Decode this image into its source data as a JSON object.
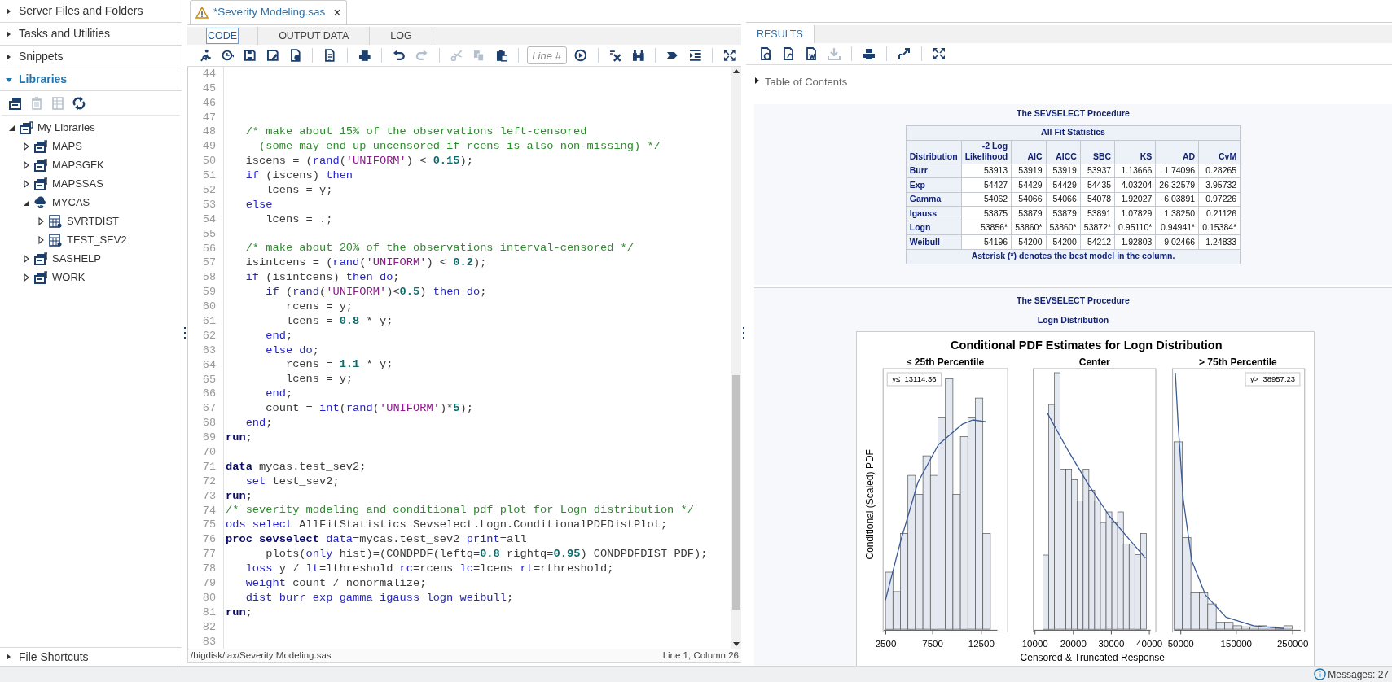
{
  "sidebar": {
    "sections": [
      {
        "label": "Server Files and Folders",
        "expanded": false
      },
      {
        "label": "Tasks and Utilities",
        "expanded": false
      },
      {
        "label": "Snippets",
        "expanded": false
      },
      {
        "label": "Libraries",
        "expanded": true
      }
    ],
    "library_toolbar": [
      {
        "kind": "new-library",
        "disabled": false
      },
      {
        "kind": "delete",
        "disabled": true
      },
      {
        "kind": "properties",
        "disabled": true
      },
      {
        "kind": "refresh",
        "disabled": false
      }
    ],
    "tree": [
      {
        "label": "My Libraries",
        "kind": "library",
        "expanded": true,
        "children": [
          {
            "label": "MAPS",
            "kind": "library",
            "expanded": false
          },
          {
            "label": "MAPSGFK",
            "kind": "library",
            "expanded": false
          },
          {
            "label": "MAPSSAS",
            "kind": "library",
            "expanded": false
          },
          {
            "label": "MYCAS",
            "kind": "cas-library",
            "expanded": true,
            "children": [
              {
                "label": "SVRTDIST",
                "kind": "table",
                "expanded": false
              },
              {
                "label": "TEST_SEV2",
                "kind": "table",
                "expanded": false
              }
            ]
          },
          {
            "label": "SASHELP",
            "kind": "library",
            "expanded": false
          },
          {
            "label": "WORK",
            "kind": "library",
            "expanded": false
          }
        ]
      }
    ],
    "footer_section": {
      "label": "File Shortcuts",
      "expanded": false
    }
  },
  "editor": {
    "tab": {
      "title": "*Severity Modeling.sas",
      "close": "×"
    },
    "subtabs": [
      {
        "label": "CODE",
        "selected": true
      },
      {
        "label": "OUTPUT DATA",
        "selected": false
      },
      {
        "label": "LOG",
        "selected": false
      }
    ],
    "toolbar": [
      {
        "kind": "run",
        "disabled": false
      },
      {
        "kind": "history",
        "disabled": false
      },
      {
        "kind": "save",
        "disabled": false
      },
      {
        "kind": "save-as",
        "disabled": false
      },
      {
        "kind": "save-other",
        "disabled": false
      },
      {
        "kind": "separator"
      },
      {
        "kind": "document",
        "disabled": false
      },
      {
        "kind": "separator"
      },
      {
        "kind": "print",
        "disabled": false
      },
      {
        "kind": "separator"
      },
      {
        "kind": "undo",
        "disabled": false
      },
      {
        "kind": "redo",
        "disabled": true
      },
      {
        "kind": "separator"
      },
      {
        "kind": "cut",
        "disabled": true
      },
      {
        "kind": "copy",
        "disabled": true
      },
      {
        "kind": "paste",
        "disabled": false
      },
      {
        "kind": "separator"
      },
      {
        "kind": "line-field",
        "placeholder": "Line #"
      },
      {
        "kind": "go",
        "disabled": false
      },
      {
        "kind": "separator"
      },
      {
        "kind": "clear",
        "disabled": false
      },
      {
        "kind": "find",
        "disabled": false
      },
      {
        "kind": "separator"
      },
      {
        "kind": "indent",
        "disabled": false
      },
      {
        "kind": "format",
        "disabled": false
      },
      {
        "kind": "separator"
      },
      {
        "kind": "fullscreen",
        "disabled": false
      }
    ],
    "lines": [
      {
        "number": "44"
      },
      {
        "number": "45"
      },
      {
        "number": "46"
      },
      {
        "number": "47"
      },
      {
        "number": "48",
        "tokens": [
          {
            "kind": "comment",
            "text": "   /* make about 15% of the observations left-censored"
          }
        ]
      },
      {
        "number": "49",
        "tokens": [
          {
            "kind": "comment",
            "text": "     (some may end up uncensored if rcens is also non-missing) */"
          }
        ]
      },
      {
        "number": "50",
        "tokens": [
          {
            "kind": "plain",
            "text": "   iscens = ("
          },
          {
            "kind": "keyword",
            "text": "rand"
          },
          {
            "kind": "plain",
            "text": "("
          },
          {
            "kind": "string",
            "text": "'UNIFORM'"
          },
          {
            "kind": "plain",
            "text": ") < "
          },
          {
            "kind": "number",
            "text": "0.15"
          },
          {
            "kind": "plain",
            "text": ");"
          }
        ]
      },
      {
        "number": "51",
        "tokens": [
          {
            "kind": "keyword",
            "text": "   if"
          },
          {
            "kind": "plain",
            "text": " (iscens) "
          },
          {
            "kind": "keyword",
            "text": "then"
          }
        ]
      },
      {
        "number": "52",
        "tokens": [
          {
            "kind": "plain",
            "text": "      lcens = y;"
          }
        ]
      },
      {
        "number": "53",
        "tokens": [
          {
            "kind": "keyword",
            "text": "   else"
          }
        ]
      },
      {
        "number": "54",
        "tokens": [
          {
            "kind": "plain",
            "text": "      lcens = .;"
          }
        ]
      },
      {
        "number": "55"
      },
      {
        "number": "56",
        "tokens": [
          {
            "kind": "comment",
            "text": "   /* make about 20% of the observations interval-censored */"
          }
        ]
      },
      {
        "number": "57",
        "tokens": [
          {
            "kind": "plain",
            "text": "   isintcens = ("
          },
          {
            "kind": "keyword",
            "text": "rand"
          },
          {
            "kind": "plain",
            "text": "("
          },
          {
            "kind": "string",
            "text": "'UNIFORM'"
          },
          {
            "kind": "plain",
            "text": ") < "
          },
          {
            "kind": "number",
            "text": "0.2"
          },
          {
            "kind": "plain",
            "text": ");"
          }
        ]
      },
      {
        "number": "58",
        "tokens": [
          {
            "kind": "keyword",
            "text": "   if"
          },
          {
            "kind": "plain",
            "text": " (isintcens) "
          },
          {
            "kind": "keyword",
            "text": "then do"
          },
          {
            "kind": "plain",
            "text": ";"
          }
        ]
      },
      {
        "number": "59",
        "tokens": [
          {
            "kind": "keyword",
            "text": "      if"
          },
          {
            "kind": "plain",
            "text": " ("
          },
          {
            "kind": "keyword",
            "text": "rand"
          },
          {
            "kind": "plain",
            "text": "("
          },
          {
            "kind": "string",
            "text": "'UNIFORM'"
          },
          {
            "kind": "plain",
            "text": ")<"
          },
          {
            "kind": "number",
            "text": "0.5"
          },
          {
            "kind": "plain",
            "text": ") "
          },
          {
            "kind": "keyword",
            "text": "then do"
          },
          {
            "kind": "plain",
            "text": ";"
          }
        ]
      },
      {
        "number": "60",
        "tokens": [
          {
            "kind": "plain",
            "text": "         rcens = y;"
          }
        ]
      },
      {
        "number": "61",
        "tokens": [
          {
            "kind": "plain",
            "text": "         lcens = "
          },
          {
            "kind": "number",
            "text": "0.8"
          },
          {
            "kind": "plain",
            "text": " * y;"
          }
        ]
      },
      {
        "number": "62",
        "tokens": [
          {
            "kind": "keyword",
            "text": "      end"
          },
          {
            "kind": "plain",
            "text": ";"
          }
        ]
      },
      {
        "number": "63",
        "tokens": [
          {
            "kind": "keyword",
            "text": "      else do"
          },
          {
            "kind": "plain",
            "text": ";"
          }
        ]
      },
      {
        "number": "64",
        "tokens": [
          {
            "kind": "plain",
            "text": "         rcens = "
          },
          {
            "kind": "number",
            "text": "1.1"
          },
          {
            "kind": "plain",
            "text": " * y;"
          }
        ]
      },
      {
        "number": "65",
        "tokens": [
          {
            "kind": "plain",
            "text": "         lcens = y;"
          }
        ]
      },
      {
        "number": "66",
        "tokens": [
          {
            "kind": "keyword",
            "text": "      end"
          },
          {
            "kind": "plain",
            "text": ";"
          }
        ]
      },
      {
        "number": "67",
        "tokens": [
          {
            "kind": "plain",
            "text": "      count = "
          },
          {
            "kind": "keyword",
            "text": "int"
          },
          {
            "kind": "plain",
            "text": "("
          },
          {
            "kind": "keyword",
            "text": "rand"
          },
          {
            "kind": "plain",
            "text": "("
          },
          {
            "kind": "string",
            "text": "'UNIFORM'"
          },
          {
            "kind": "plain",
            "text": ")*"
          },
          {
            "kind": "number",
            "text": "5"
          },
          {
            "kind": "plain",
            "text": ");"
          }
        ]
      },
      {
        "number": "68",
        "tokens": [
          {
            "kind": "keyword",
            "text": "   end"
          },
          {
            "kind": "plain",
            "text": ";"
          }
        ]
      },
      {
        "number": "69",
        "tokens": [
          {
            "kind": "step",
            "text": "run"
          },
          {
            "kind": "plain",
            "text": ";"
          }
        ]
      },
      {
        "number": "70"
      },
      {
        "number": "71",
        "tokens": [
          {
            "kind": "step",
            "text": "data"
          },
          {
            "kind": "plain",
            "text": " mycas.test_sev2;"
          }
        ]
      },
      {
        "number": "72",
        "tokens": [
          {
            "kind": "keyword",
            "text": "   set"
          },
          {
            "kind": "plain",
            "text": " test_sev2;"
          }
        ]
      },
      {
        "number": "73",
        "tokens": [
          {
            "kind": "step",
            "text": "run"
          },
          {
            "kind": "plain",
            "text": ";"
          }
        ]
      },
      {
        "number": "74",
        "tokens": [
          {
            "kind": "comment",
            "text": "/* severity modeling and conditional pdf plot for Logn distribution */"
          }
        ]
      },
      {
        "number": "75",
        "tokens": [
          {
            "kind": "keyword",
            "text": "ods select"
          },
          {
            "kind": "plain",
            "text": " AllFitStatistics Sevselect.Logn.ConditionalPDFDistPlot;"
          }
        ]
      },
      {
        "number": "76",
        "tokens": [
          {
            "kind": "step",
            "text": "proc sevselect"
          },
          {
            "kind": "keyword",
            "text": " data"
          },
          {
            "kind": "plain",
            "text": "=mycas.test_sev2 "
          },
          {
            "kind": "keyword",
            "text": "print"
          },
          {
            "kind": "plain",
            "text": "=all"
          }
        ]
      },
      {
        "number": "77",
        "tokens": [
          {
            "kind": "plain",
            "text": "      plots("
          },
          {
            "kind": "keyword",
            "text": "only"
          },
          {
            "kind": "plain",
            "text": " hist)=(CONDPDF(leftq="
          },
          {
            "kind": "number",
            "text": "0.8"
          },
          {
            "kind": "plain",
            "text": " rightq="
          },
          {
            "kind": "number",
            "text": "0.95"
          },
          {
            "kind": "plain",
            "text": ") CONDPDFDIST PDF);"
          }
        ]
      },
      {
        "number": "78",
        "tokens": [
          {
            "kind": "keyword",
            "text": "   loss"
          },
          {
            "kind": "plain",
            "text": " y / "
          },
          {
            "kind": "keyword",
            "text": "lt"
          },
          {
            "kind": "plain",
            "text": "=lthreshold "
          },
          {
            "kind": "keyword",
            "text": "rc"
          },
          {
            "kind": "plain",
            "text": "=rcens "
          },
          {
            "kind": "keyword",
            "text": "lc"
          },
          {
            "kind": "plain",
            "text": "=lcens "
          },
          {
            "kind": "keyword",
            "text": "rt"
          },
          {
            "kind": "plain",
            "text": "=rthreshold;"
          }
        ]
      },
      {
        "number": "79",
        "tokens": [
          {
            "kind": "keyword",
            "text": "   weight"
          },
          {
            "kind": "plain",
            "text": " count / nonormalize;"
          }
        ]
      },
      {
        "number": "80",
        "tokens": [
          {
            "kind": "keyword",
            "text": "   dist burr exp gamma igauss logn weibull"
          },
          {
            "kind": "plain",
            "text": ";"
          }
        ]
      },
      {
        "number": "81",
        "tokens": [
          {
            "kind": "step",
            "text": "run"
          },
          {
            "kind": "plain",
            "text": ";"
          }
        ]
      },
      {
        "number": "82"
      },
      {
        "number": "83"
      }
    ],
    "status": {
      "path": "/bigdisk/lax/Severity Modeling.sas",
      "position": "Line 1, Column 26"
    }
  },
  "results": {
    "tabs": [
      {
        "label": "RESULTS",
        "selected": true
      }
    ],
    "toolbar": [
      {
        "kind": "html-doc",
        "disabled": false
      },
      {
        "kind": "pdf-doc",
        "disabled": false
      },
      {
        "kind": "word-doc",
        "disabled": false
      },
      {
        "kind": "download",
        "disabled": true
      },
      {
        "kind": "separator"
      },
      {
        "kind": "print",
        "disabled": false
      },
      {
        "kind": "separator"
      },
      {
        "kind": "expand",
        "disabled": false
      },
      {
        "kind": "separator"
      },
      {
        "kind": "fullscreen",
        "disabled": false
      }
    ],
    "toc": {
      "label": "Table of Contents",
      "expanded": false
    },
    "procedure_title": "The SEVSELECT Procedure",
    "table": {
      "title": "All Fit Statistics",
      "columns": [
        "Distribution",
        "-2 Log Likelihood",
        "AIC",
        "AICC",
        "SBC",
        "KS",
        "AD",
        "CvM"
      ],
      "rows": [
        {
          "distribution": "Burr",
          "values": [
            "53913",
            "53919",
            "53919",
            "53937",
            "1.13666",
            "1.74096",
            "0.28265"
          ]
        },
        {
          "distribution": "Exp",
          "values": [
            "54427",
            "54429",
            "54429",
            "54435",
            "4.03204",
            "26.32579",
            "3.95732"
          ]
        },
        {
          "distribution": "Gamma",
          "values": [
            "54062",
            "54066",
            "54066",
            "54078",
            "1.92027",
            "6.03891",
            "0.97226"
          ]
        },
        {
          "distribution": "Igauss",
          "values": [
            "53875",
            "53879",
            "53879",
            "53891",
            "1.07829",
            "1.38250",
            "0.21126"
          ]
        },
        {
          "distribution": "Logn",
          "values": [
            "53856*",
            "53860*",
            "53860*",
            "53872*",
            "0.95110*",
            "0.94941*",
            "0.15384*"
          ]
        },
        {
          "distribution": "Weibull",
          "values": [
            "54196",
            "54200",
            "54200",
            "54212",
            "1.92803",
            "9.02466",
            "1.24833"
          ]
        }
      ],
      "footnote": "Asterisk (*) denotes the best model in the column."
    },
    "plot_section": {
      "procedure_title": "The SEVSELECT Procedure",
      "subtitle": "Logn Distribution",
      "chart": {
        "title": "Conditional PDF Estimates for Logn Distribution",
        "ylabel": "Conditional (Scaled) PDF",
        "xlabel": "Censored & Truncated Response",
        "panels": [
          {
            "title": "≤ 25th Percentile",
            "inset": "y≤  13114.36",
            "xticks": [
              "2500",
              "7500",
              "12500"
            ]
          },
          {
            "title": "Center",
            "xticks": [
              "10000",
              "20000",
              "30000",
              "40000"
            ]
          },
          {
            "title": "> 75th Percentile",
            "inset": "y>  38957.23",
            "xticks": [
              "50000",
              "150000",
              "250000"
            ]
          }
        ]
      }
    }
  },
  "status_bar": {
    "messages": "Messages: 27"
  }
}
